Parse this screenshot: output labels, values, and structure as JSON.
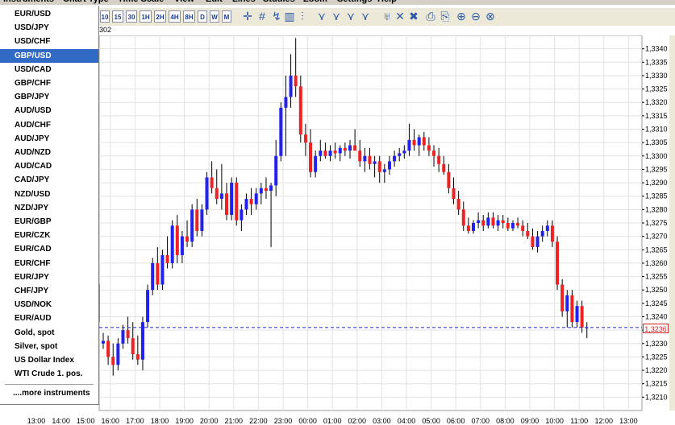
{
  "menu": [
    "Instruments",
    "Chart Type",
    "Time Scale",
    "View",
    "Edit",
    "Lines",
    "Studies",
    "Zoom",
    "Settings",
    "Help"
  ],
  "toolbar": {
    "timeframes": [
      "10",
      "15",
      "30",
      "1H",
      "2H",
      "4H",
      "8H",
      "D",
      "W",
      "M"
    ],
    "icons": [
      "crosshair-icon",
      "hash-icon",
      "cursor-icon",
      "indicator-icon",
      "candles-icon",
      "line-tool-icon",
      "fan-icon",
      "fib-icon",
      "grid-icon",
      "gann-icon",
      "delete-icon",
      "clear-icon",
      "print-icon",
      "copy-icon",
      "zoom-in-icon",
      "zoom-out-icon",
      "zoom-reset-icon"
    ],
    "subtitle": "302"
  },
  "instruments": {
    "items": [
      "EUR/USD",
      "USD/JPY",
      "USD/CHF",
      "GBP/USD",
      "USD/CAD",
      "GBP/CHF",
      "GBP/JPY",
      "AUD/USD",
      "AUD/CHF",
      "AUD/JPY",
      "AUD/NZD",
      "AUD/CAD",
      "CAD/JPY",
      "NZD/USD",
      "NZD/JPY",
      "EUR/GBP",
      "EUR/CZK",
      "EUR/CAD",
      "EUR/CHF",
      "EUR/JPY",
      "CHF/JPY",
      "USD/NOK",
      "EUR/AUD",
      "Gold, spot",
      "Silver, spot",
      "US Dollar Index",
      "WTI Crude 1. pos."
    ],
    "selected": "GBP/USD",
    "more": "....more instruments"
  },
  "colors": {
    "up": "#2222ee",
    "down": "#ee2222",
    "wick": "#000000",
    "current_line": "#2222cc"
  },
  "chart_data": {
    "type": "candlestick",
    "ylim": [
      1.3205,
      1.3345
    ],
    "y_ticks": [
      "1,3210",
      "1,3215",
      "1,3220",
      "1,3225",
      "1,3230",
      "1,3235",
      "1,3240",
      "1,3245",
      "1,3250",
      "1,3255",
      "1,3260",
      "1,3265",
      "1,3270",
      "1,3275",
      "1,3280",
      "1,3285",
      "1,3290",
      "1,3295",
      "1,3300",
      "1,3305",
      "1,3310",
      "1,3315",
      "1,3320",
      "1,3325",
      "1,3330",
      "1,3335",
      "1,3340"
    ],
    "x_ticks": [
      "13:00",
      "14:00",
      "15:00",
      "16:00",
      "17:00",
      "18:00",
      "19:00",
      "20:00",
      "21:00",
      "22:00",
      "23:00",
      "00:00",
      "01:00",
      "02:00",
      "03:00",
      "04:00",
      "05:00",
      "06:00",
      "07:00",
      "08:00",
      "09:00",
      "10:00",
      "11:00",
      "12:00",
      "13:00"
    ],
    "current_price": "1,3236",
    "current_value": 1.3236,
    "candles": [
      [
        1.323,
        1.3234,
        1.3228,
        1.3231
      ],
      [
        1.3231,
        1.3233,
        1.3222,
        1.3225
      ],
      [
        1.3225,
        1.323,
        1.3218,
        1.3222
      ],
      [
        1.3222,
        1.3232,
        1.322,
        1.323
      ],
      [
        1.323,
        1.3237,
        1.3228,
        1.3235
      ],
      [
        1.3235,
        1.324,
        1.323,
        1.3232
      ],
      [
        1.3232,
        1.3238,
        1.3224,
        1.3226
      ],
      [
        1.3226,
        1.3233,
        1.3222,
        1.3224
      ],
      [
        1.3224,
        1.324,
        1.322,
        1.3238
      ],
      [
        1.3238,
        1.3252,
        1.3236,
        1.325
      ],
      [
        1.325,
        1.3262,
        1.3248,
        1.326
      ],
      [
        1.326,
        1.3266,
        1.325,
        1.3252
      ],
      [
        1.3252,
        1.3265,
        1.325,
        1.3263
      ],
      [
        1.3263,
        1.327,
        1.3258,
        1.326
      ],
      [
        1.326,
        1.3276,
        1.3258,
        1.3274
      ],
      [
        1.3274,
        1.3278,
        1.326,
        1.3263
      ],
      [
        1.3263,
        1.3272,
        1.326,
        1.327
      ],
      [
        1.327,
        1.3276,
        1.3266,
        1.3268
      ],
      [
        1.3268,
        1.3282,
        1.3266,
        1.328
      ],
      [
        1.328,
        1.3284,
        1.327,
        1.3272
      ],
      [
        1.3272,
        1.3282,
        1.327,
        1.328
      ],
      [
        1.328,
        1.3294,
        1.3278,
        1.3292
      ],
      [
        1.3292,
        1.3298,
        1.3286,
        1.3288
      ],
      [
        1.3288,
        1.3295,
        1.3282,
        1.3284
      ],
      [
        1.3284,
        1.3297,
        1.328,
        1.3286
      ],
      [
        1.3286,
        1.329,
        1.3276,
        1.3278
      ],
      [
        1.3278,
        1.3292,
        1.3276,
        1.329
      ],
      [
        1.329,
        1.3292,
        1.3274,
        1.3276
      ],
      [
        1.3276,
        1.3282,
        1.3272,
        1.328
      ],
      [
        1.328,
        1.3286,
        1.3278,
        1.3284
      ],
      [
        1.3284,
        1.3288,
        1.3278,
        1.3282
      ],
      [
        1.3282,
        1.3288,
        1.328,
        1.3286
      ],
      [
        1.3286,
        1.329,
        1.3282,
        1.3288
      ],
      [
        1.3288,
        1.3292,
        1.3284,
        1.3287
      ],
      [
        1.3287,
        1.329,
        1.3266,
        1.3289
      ],
      [
        1.3289,
        1.3306,
        1.3285,
        1.33
      ],
      [
        1.33,
        1.332,
        1.3298,
        1.3318
      ],
      [
        1.3318,
        1.333,
        1.33,
        1.3322
      ],
      [
        1.3322,
        1.3338,
        1.3318,
        1.333
      ],
      [
        1.333,
        1.3344,
        1.3322,
        1.3326
      ],
      [
        1.3326,
        1.333,
        1.3305,
        1.3308
      ],
      [
        1.3308,
        1.3312,
        1.33,
        1.3305
      ],
      [
        1.3305,
        1.331,
        1.3292,
        1.3294
      ],
      [
        1.3294,
        1.3302,
        1.3292,
        1.33
      ],
      [
        1.33,
        1.3306,
        1.3298,
        1.3302
      ],
      [
        1.3302,
        1.3305,
        1.3299,
        1.33
      ],
      [
        1.33,
        1.3304,
        1.3298,
        1.3302
      ],
      [
        1.3302,
        1.3305,
        1.3299,
        1.3301
      ],
      [
        1.3301,
        1.3304,
        1.3298,
        1.3303
      ],
      [
        1.3303,
        1.3305,
        1.33,
        1.3302
      ],
      [
        1.3302,
        1.3306,
        1.3299,
        1.3304
      ],
      [
        1.3304,
        1.331,
        1.3302,
        1.3302
      ],
      [
        1.3302,
        1.3306,
        1.3296,
        1.3298
      ],
      [
        1.3298,
        1.3303,
        1.3294,
        1.33
      ],
      [
        1.33,
        1.3303,
        1.3295,
        1.3297
      ],
      [
        1.3297,
        1.33,
        1.3292,
        1.3298
      ],
      [
        1.3298,
        1.33,
        1.329,
        1.3294
      ],
      [
        1.3294,
        1.3297,
        1.329,
        1.3295
      ],
      [
        1.3295,
        1.33,
        1.3293,
        1.3298
      ],
      [
        1.3298,
        1.3302,
        1.3296,
        1.33
      ],
      [
        1.33,
        1.3303,
        1.3298,
        1.3301
      ],
      [
        1.3301,
        1.3304,
        1.3299,
        1.3302
      ],
      [
        1.3302,
        1.3312,
        1.33,
        1.3306
      ],
      [
        1.3306,
        1.331,
        1.3302,
        1.3304
      ],
      [
        1.3304,
        1.3308,
        1.33,
        1.3307
      ],
      [
        1.3307,
        1.3309,
        1.3302,
        1.3304
      ],
      [
        1.3304,
        1.3307,
        1.33,
        1.3302
      ],
      [
        1.3302,
        1.3304,
        1.3296,
        1.33
      ],
      [
        1.33,
        1.3303,
        1.3294,
        1.3297
      ],
      [
        1.3297,
        1.33,
        1.3293,
        1.3294
      ],
      [
        1.3294,
        1.3297,
        1.3286,
        1.3288
      ],
      [
        1.3288,
        1.3292,
        1.3282,
        1.3284
      ],
      [
        1.3284,
        1.3287,
        1.3278,
        1.328
      ],
      [
        1.328,
        1.3283,
        1.3272,
        1.3274
      ],
      [
        1.3274,
        1.3277,
        1.3271,
        1.3272
      ],
      [
        1.3272,
        1.3276,
        1.3271,
        1.3275
      ],
      [
        1.3275,
        1.3279,
        1.3273,
        1.3276
      ],
      [
        1.3276,
        1.3278,
        1.3272,
        1.3274
      ],
      [
        1.3274,
        1.3279,
        1.3273,
        1.3277
      ],
      [
        1.3277,
        1.3279,
        1.3273,
        1.3274
      ],
      [
        1.3274,
        1.3278,
        1.3272,
        1.3276
      ],
      [
        1.3276,
        1.3278,
        1.3273,
        1.3275
      ],
      [
        1.3275,
        1.3277,
        1.3272,
        1.3273
      ],
      [
        1.3273,
        1.3276,
        1.3272,
        1.3275
      ],
      [
        1.3275,
        1.3277,
        1.3273,
        1.3274
      ],
      [
        1.3274,
        1.3276,
        1.327,
        1.3272
      ],
      [
        1.3272,
        1.3275,
        1.3269,
        1.327
      ],
      [
        1.327,
        1.3273,
        1.3265,
        1.3266
      ],
      [
        1.3266,
        1.3272,
        1.3264,
        1.327
      ],
      [
        1.327,
        1.3274,
        1.3268,
        1.3272
      ],
      [
        1.3272,
        1.3276,
        1.327,
        1.3274
      ],
      [
        1.3274,
        1.3276,
        1.3266,
        1.3268
      ],
      [
        1.3268,
        1.327,
        1.325,
        1.3252
      ],
      [
        1.3252,
        1.3254,
        1.324,
        1.3242
      ],
      [
        1.3242,
        1.325,
        1.3236,
        1.3248
      ],
      [
        1.3248,
        1.325,
        1.3236,
        1.3238
      ],
      [
        1.3238,
        1.3246,
        1.3236,
        1.3244
      ],
      [
        1.3244,
        1.3246,
        1.3234,
        1.3236
      ],
      [
        1.3236,
        1.3238,
        1.3232,
        1.3236
      ]
    ]
  }
}
